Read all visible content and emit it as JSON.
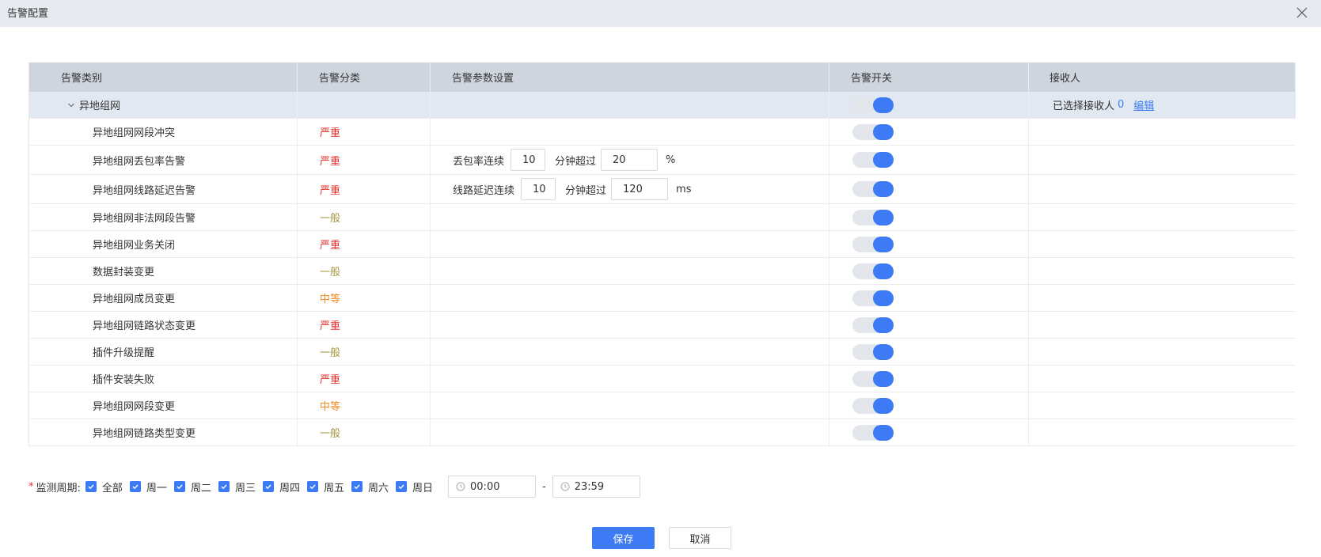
{
  "dialog": {
    "title": "告警配置",
    "close_icon": "close-icon"
  },
  "table": {
    "headers": [
      "告警类别",
      "告警分类",
      "告警参数设置",
      "告警开关",
      "接收人"
    ],
    "group": {
      "name": "异地组网",
      "enabled": true,
      "receiver_label": "已选择接收人",
      "receiver_count": "0",
      "edit_label": "编辑"
    },
    "rows": [
      {
        "name": "异地组网网段冲突",
        "severity": "严重",
        "enabled": true
      },
      {
        "name": "异地组网丢包率告警",
        "severity": "严重",
        "enabled": true,
        "param": {
          "prefix": "丢包率连续",
          "value1": "10",
          "middle": "分钟超过",
          "value2": "20",
          "unit": "%"
        }
      },
      {
        "name": "异地组网线路延迟告警",
        "severity": "严重",
        "enabled": true,
        "param": {
          "prefix": "线路延迟连续",
          "value1": "10",
          "middle": "分钟超过",
          "value2": "120",
          "unit": "ms"
        }
      },
      {
        "name": "异地组网非法网段告警",
        "severity": "一般",
        "enabled": true
      },
      {
        "name": "异地组网业务关闭",
        "severity": "严重",
        "enabled": true
      },
      {
        "name": "数据封装变更",
        "severity": "一般",
        "enabled": true
      },
      {
        "name": "异地组网成员变更",
        "severity": "中等",
        "enabled": true
      },
      {
        "name": "异地组网链路状态变更",
        "severity": "严重",
        "enabled": true
      },
      {
        "name": "插件升级提醒",
        "severity": "一般",
        "enabled": true
      },
      {
        "name": "插件安装失败",
        "severity": "严重",
        "enabled": true
      },
      {
        "name": "异地组网网段变更",
        "severity": "中等",
        "enabled": true
      },
      {
        "name": "异地组网链路类型变更",
        "severity": "一般",
        "enabled": true
      }
    ]
  },
  "severity_colors": {
    "严重": "#e0302c",
    "中等": "#f08a24",
    "一般": "#a39a3e"
  },
  "accent_color": "#3c7bf5",
  "period": {
    "required_mark": "*",
    "label": "监测周期:",
    "options": [
      {
        "label": "全部",
        "checked": true
      },
      {
        "label": "周一",
        "checked": true
      },
      {
        "label": "周二",
        "checked": true
      },
      {
        "label": "周三",
        "checked": true
      },
      {
        "label": "周四",
        "checked": true
      },
      {
        "label": "周五",
        "checked": true
      },
      {
        "label": "周六",
        "checked": true
      },
      {
        "label": "周日",
        "checked": true
      }
    ],
    "start_time": "00:00",
    "separator": "-",
    "end_time": "23:59"
  },
  "footer": {
    "save_label": "保存",
    "cancel_label": "取消"
  }
}
